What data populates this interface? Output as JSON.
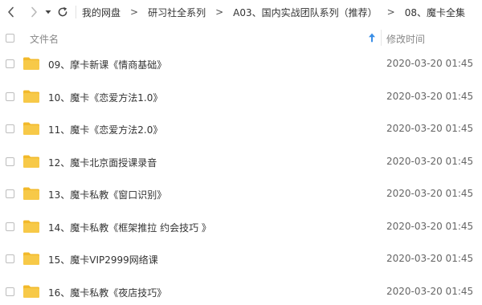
{
  "breadcrumb": [
    "我的网盘",
    "研习社全系列",
    "A03、国内实战团队系列（推荐）",
    "08、魔卡全集"
  ],
  "breadcrumb_separator": ">",
  "header": {
    "name_label": "文件名",
    "date_label": "修改时间",
    "sort_direction": "ascending"
  },
  "colors": {
    "folder": "#f7c948",
    "folder_tab": "#f2b92a",
    "sort_arrow": "#3a8ee6"
  },
  "files": [
    {
      "name": "09、摩卡新课《情商基础》",
      "modified": "2020-03-20 01:45"
    },
    {
      "name": "10、魔卡《恋爱方法1.0》",
      "modified": "2020-03-20 01:45"
    },
    {
      "name": "11、魔卡《恋爱方法2.0》",
      "modified": "2020-03-20 01:45"
    },
    {
      "name": "12、魔卡北京面授课录音",
      "modified": "2020-03-20 01:45"
    },
    {
      "name": "13、魔卡私教《窗口识别》",
      "modified": "2020-03-20 01:45"
    },
    {
      "name": "14、魔卡私教《框架推拉 约会技巧 》",
      "modified": "2020-03-20 01:45"
    },
    {
      "name": "15、魔卡VIP2999网络课",
      "modified": "2020-03-20 01:45"
    },
    {
      "name": "16、魔卡私教《夜店技巧》",
      "modified": "2020-03-20 01:45"
    }
  ],
  "icons": {
    "back": "chevron-left-icon",
    "forward": "chevron-right-icon",
    "history": "caret-down-icon",
    "refresh": "refresh-icon",
    "folder": "folder-icon",
    "sort": "sort-up-arrow-icon"
  }
}
